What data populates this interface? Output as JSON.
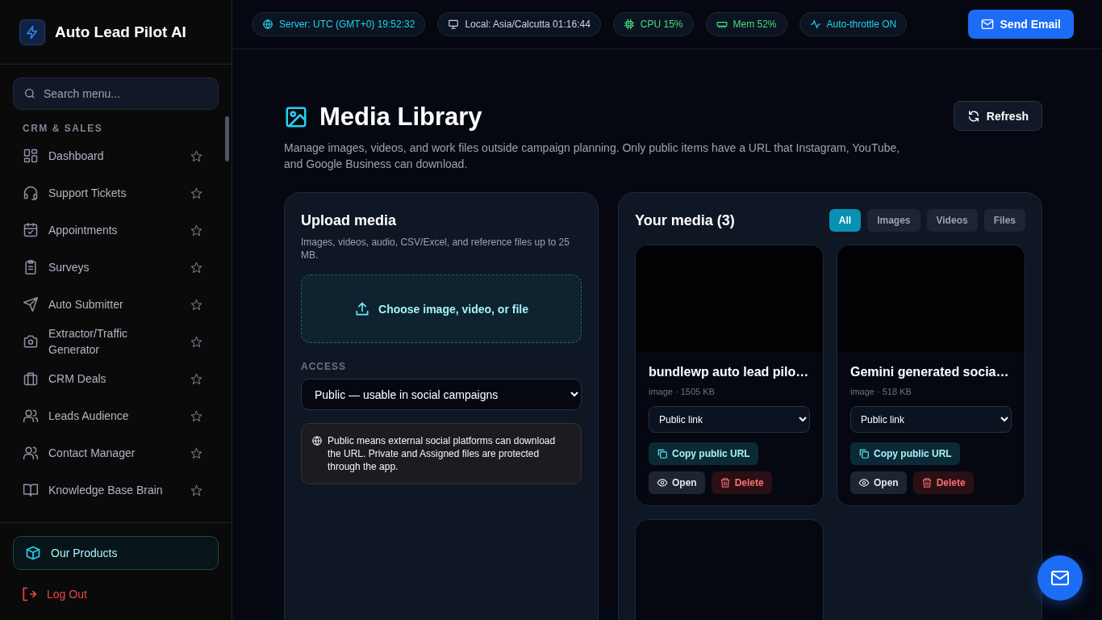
{
  "brand": {
    "name": "Auto Lead Pilot AI"
  },
  "sidebar": {
    "search": {
      "placeholder": "Search menu..."
    },
    "section": "CRM & SALES",
    "items": [
      {
        "label": "Dashboard"
      },
      {
        "label": "Support Tickets"
      },
      {
        "label": "Appointments"
      },
      {
        "label": "Surveys"
      },
      {
        "label": "Auto Submitter"
      },
      {
        "label": "Extractor/Traffic Generator"
      },
      {
        "label": "CRM Deals"
      },
      {
        "label": "Leads Audience"
      },
      {
        "label": "Contact Manager"
      },
      {
        "label": "Knowledge Base Brain"
      }
    ],
    "products": "Our Products",
    "logout": "Log Out"
  },
  "topbar": {
    "pills": [
      {
        "label": "Server: UTC (GMT+0) 19:52:32",
        "color": "#22d3ee"
      },
      {
        "label": "Local: Asia/Calcutta 01:16:44",
        "color": "#cbd5e1"
      },
      {
        "label": "CPU 15%",
        "color": "#4ade80"
      },
      {
        "label": "Mem 52%",
        "color": "#4ade80"
      },
      {
        "label": "Auto-throttle ON",
        "color": "#22d3ee"
      }
    ],
    "send_button": "Send Email"
  },
  "page": {
    "title": "Media Library",
    "description": "Manage images, videos, and work files outside campaign planning. Only public items have a URL that Instagram, YouTube, and Google Business can download.",
    "refresh": "Refresh"
  },
  "upload": {
    "title": "Upload media",
    "hint": "Images, videos, audio, CSV/Excel, and reference files up to 25 MB.",
    "dropzone": "Choose image, video, or file",
    "access_label": "ACCESS",
    "access_value": "Public — usable in social campaigns",
    "note": "Public means external social platforms can download the URL. Private and Assigned files are protected through the app."
  },
  "media": {
    "title": "Your media (3)",
    "filters": [
      {
        "label": "All",
        "selected": true
      },
      {
        "label": "Images",
        "selected": false
      },
      {
        "label": "Videos",
        "selected": false
      },
      {
        "label": "Files",
        "selected": false
      }
    ],
    "items": [
      {
        "kind": "file",
        "name": "bundlewp auto lead pilo…",
        "meta": "image · 1505 KB",
        "access": "Public link",
        "copy": "Copy public URL",
        "open": "Open",
        "delete": "Delete"
      },
      {
        "kind": "file",
        "name": "Gemini generated socia…",
        "meta": "image · 518 KB",
        "access": "Public link",
        "copy": "Copy public URL",
        "open": "Open",
        "delete": "Delete"
      },
      {
        "kind": "picture"
      }
    ]
  }
}
